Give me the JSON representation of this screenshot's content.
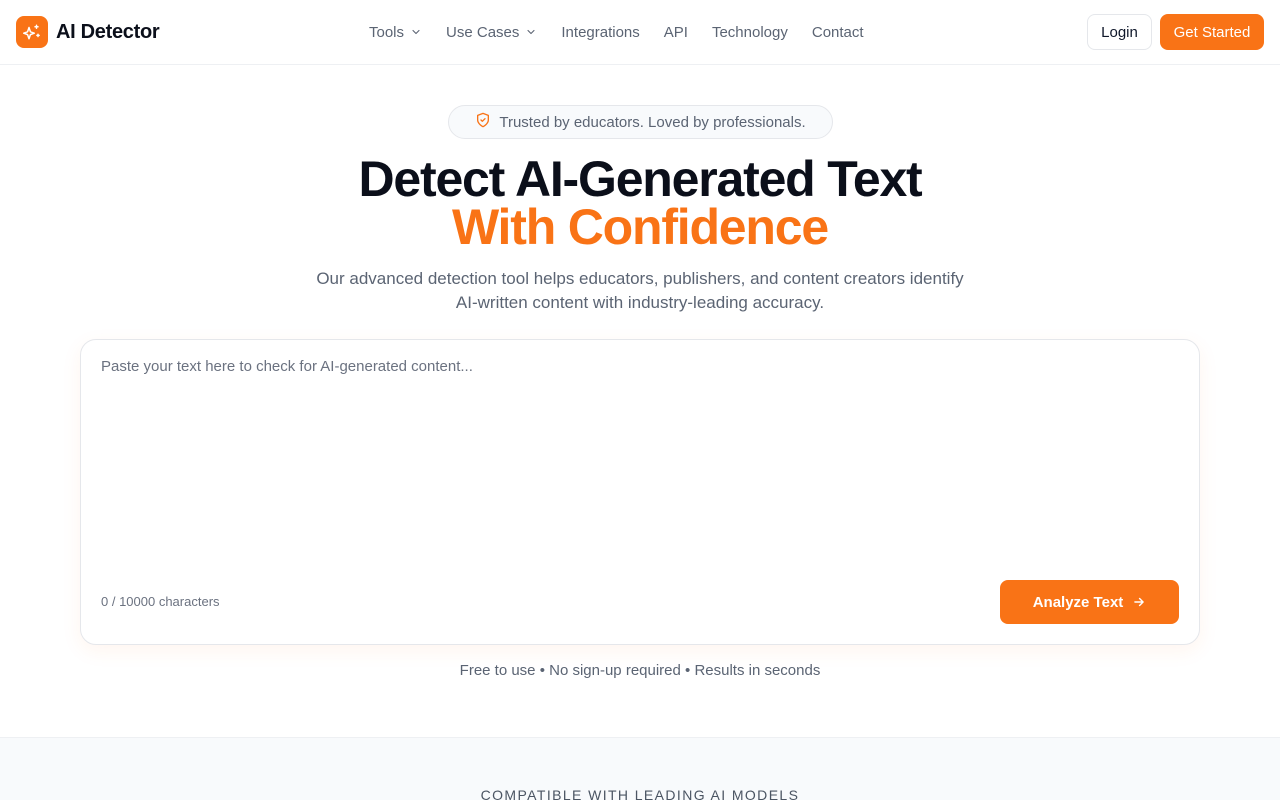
{
  "brand": {
    "name": "AI Detector",
    "logo_icon": "sparkles-icon",
    "accent": "#f97316"
  },
  "nav": {
    "items": [
      {
        "label": "Tools",
        "has_dropdown": true
      },
      {
        "label": "Use Cases",
        "has_dropdown": true
      },
      {
        "label": "Integrations",
        "has_dropdown": false
      },
      {
        "label": "API",
        "has_dropdown": false
      },
      {
        "label": "Technology",
        "has_dropdown": false
      },
      {
        "label": "Contact",
        "has_dropdown": false
      }
    ],
    "login_label": "Login",
    "cta_label": "Get Started"
  },
  "hero": {
    "badge_icon": "shield-check-icon",
    "badge_text": "Trusted by educators. Loved by professionals.",
    "title_line1": "Detect AI-Generated Text",
    "title_line2": "With Confidence",
    "subtitle_line1": "Our advanced detection tool helps educators, publishers, and content creators identify",
    "subtitle_line2": "AI-written content with industry-leading accuracy."
  },
  "detector": {
    "input_value": "",
    "placeholder": "Paste your text here to check for AI-generated content...",
    "counter": "0 / 10000 characters",
    "analyze_label": "Analyze Text",
    "analyze_icon": "arrow-right-icon"
  },
  "note": "Free to use • No sign-up required • Results in seconds",
  "compatible": {
    "title": "COMPATIBLE WITH LEADING AI MODELS"
  }
}
